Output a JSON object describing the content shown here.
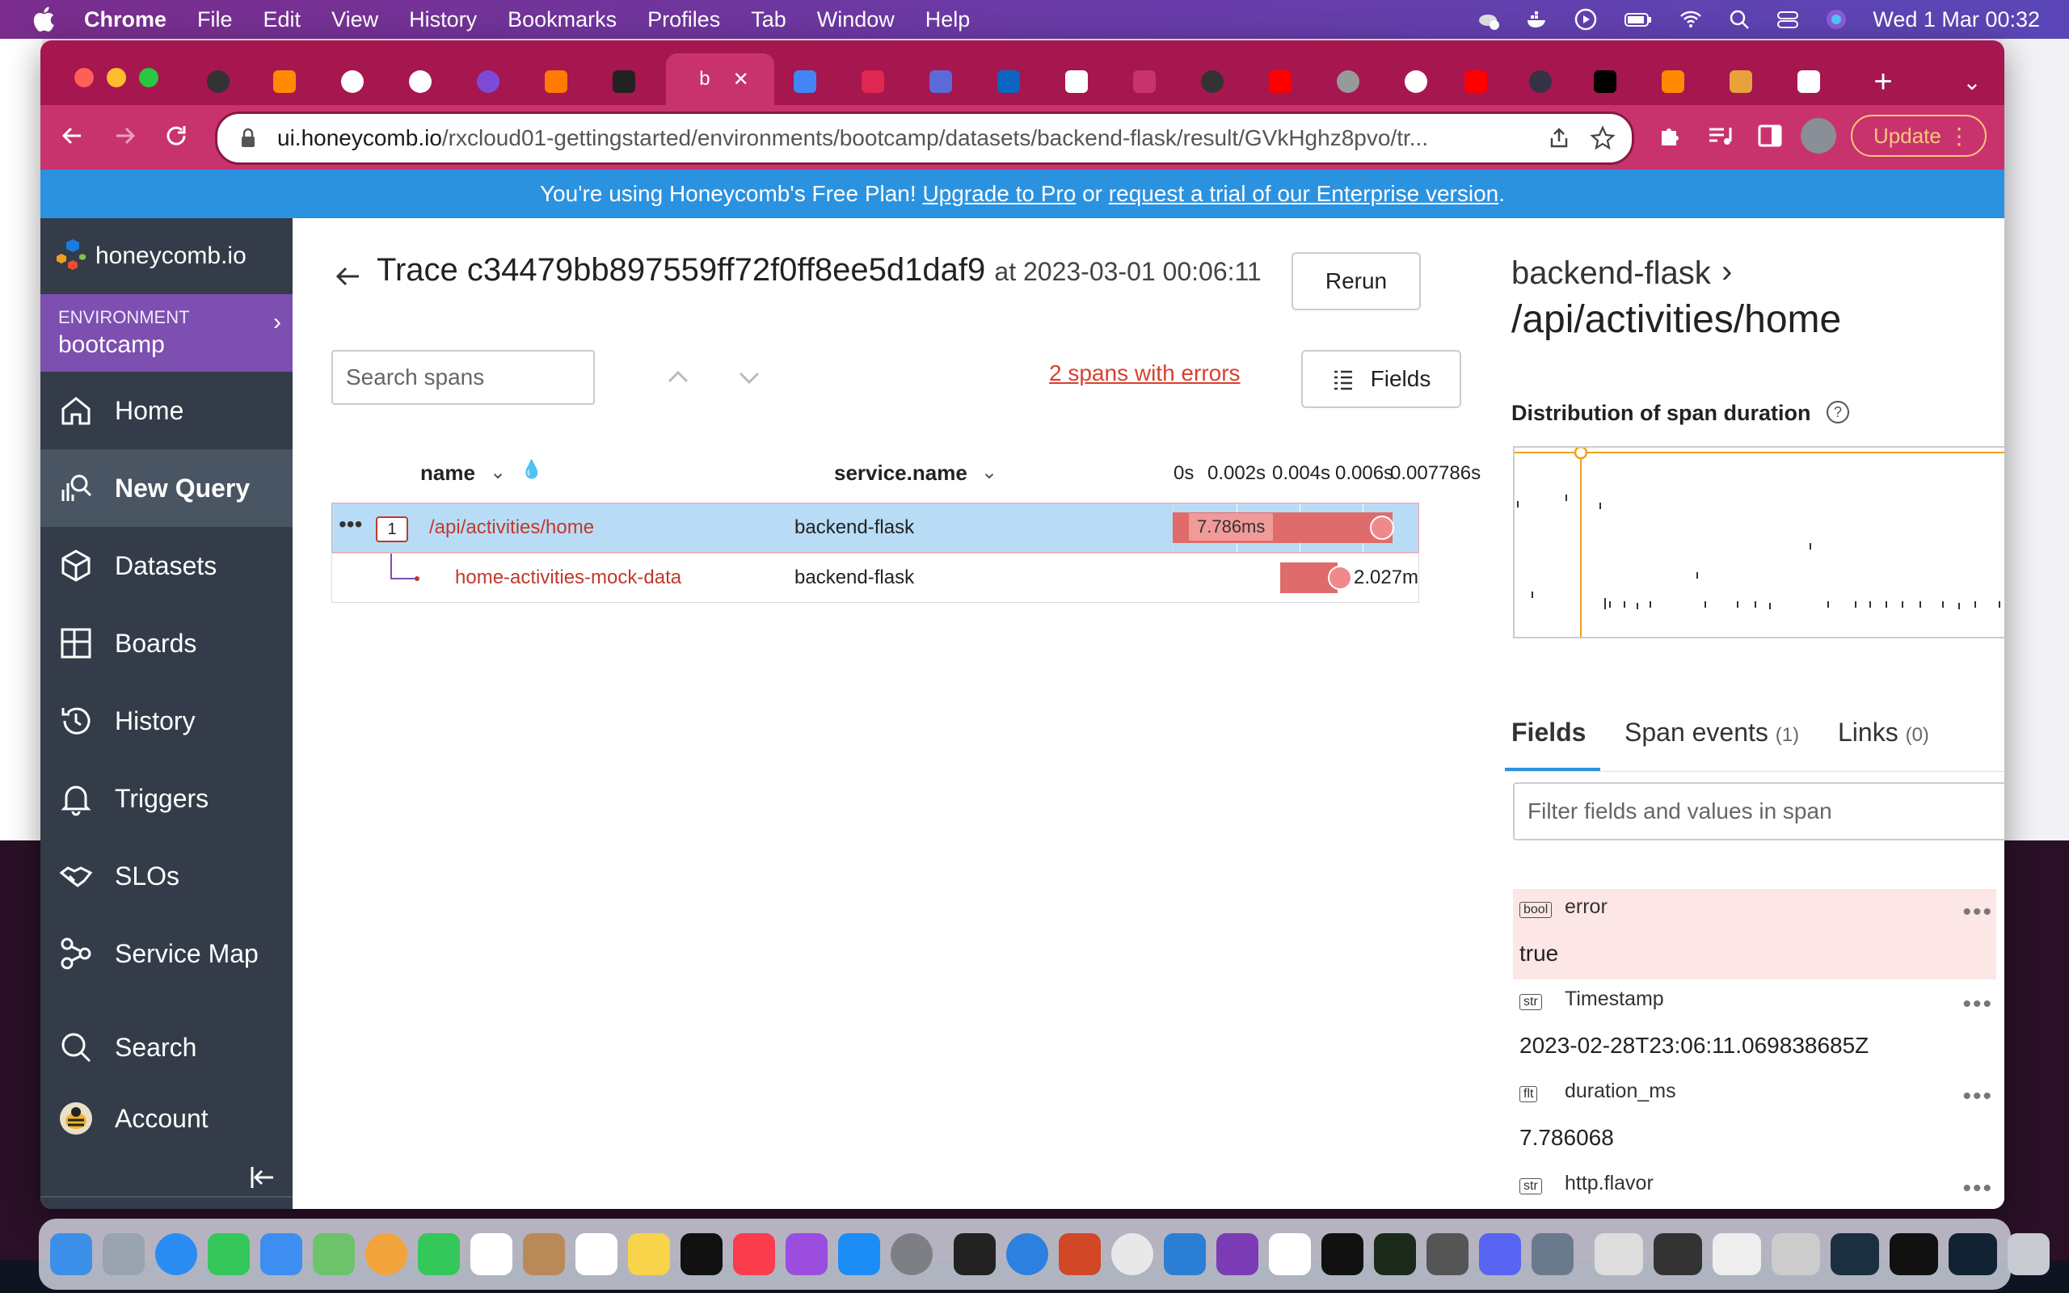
{
  "menubar": {
    "app_name": "Chrome",
    "items": [
      "File",
      "Edit",
      "View",
      "History",
      "Bookmarks",
      "Profiles",
      "Tab",
      "Window",
      "Help"
    ],
    "clock": "Wed 1 Mar  00:32"
  },
  "browser": {
    "active_tab_label": "b",
    "url_host": "ui.honeycomb.io",
    "url_path": "/rxcloud01-gettingstarted/environments/bootcamp/datasets/backend-flask/result/GVkHghz8pvo/tr...",
    "update_label": "Update"
  },
  "banner": {
    "prefix": "You're using Honeycomb's Free Plan!",
    "link1": "Upgrade to Pro",
    "middle": "or",
    "link2": "request a trial of our Enterprise version",
    "suffix": "."
  },
  "sidebar": {
    "logo_text": "honeycomb.io",
    "env_label": "ENVIRONMENT",
    "env_value": "bootcamp",
    "items": [
      {
        "label": "Home",
        "icon": "home-icon"
      },
      {
        "label": "New Query",
        "icon": "query-icon",
        "active": true
      },
      {
        "label": "Datasets",
        "icon": "dataset-icon"
      },
      {
        "label": "Boards",
        "icon": "boards-icon"
      },
      {
        "label": "History",
        "icon": "history-icon"
      },
      {
        "label": "Triggers",
        "icon": "bell-icon"
      },
      {
        "label": "SLOs",
        "icon": "handshake-icon"
      },
      {
        "label": "Service Map",
        "icon": "service-map-icon"
      }
    ],
    "search_label": "Search",
    "account_label": "Account"
  },
  "trace": {
    "title": "Trace c34479bb897559ff72f0ff8ee5d1daf9",
    "at": "at 2023-03-01 00:06:11",
    "rerun_label": "Rerun",
    "search_placeholder": "Search spans",
    "errors_link": "2 spans with errors",
    "fields_label": "Fields",
    "col_name": "name",
    "col_service": "service.name",
    "ticks": [
      "0s",
      "0.002s",
      "0.004s",
      "0.006s",
      "0.007786s"
    ],
    "spans": [
      {
        "count": "1",
        "name": "/api/activities/home",
        "service": "backend-flask",
        "duration": "7.786ms",
        "start_frac": 0.0,
        "len_frac": 1.0
      },
      {
        "name": "home-activities-mock-data",
        "service": "backend-flask",
        "duration": "2.027m",
        "start_frac": 0.49,
        "len_frac": 0.26
      }
    ]
  },
  "detail": {
    "service": "backend-flask",
    "route": "/api/activities/home",
    "dist_title": "Distribution of span duration",
    "tabs": [
      {
        "label": "Fields",
        "count": ""
      },
      {
        "label": "Span events",
        "count": "(1)"
      },
      {
        "label": "Links",
        "count": "(0)"
      }
    ],
    "filter_placeholder": "Filter fields and values in span",
    "fields": [
      {
        "type": "bool",
        "key": "error",
        "value": "true",
        "highlight": true
      },
      {
        "type": "str",
        "key": "Timestamp",
        "value": "2023-02-28T23:06:11.069838685Z"
      },
      {
        "type": "flt",
        "key": "duration_ms",
        "value": "7.786068"
      },
      {
        "type": "str",
        "key": "http.flavor",
        "value": ""
      }
    ]
  },
  "colors": {
    "tabbar": "#a6164f",
    "toolbar": "#c9336d",
    "banner": "#2b92e0",
    "sidebar": "#333c48",
    "env": "#7d4fb0",
    "error_red": "#d9402f",
    "span_bar": "#e06b6b",
    "selected_row": "#b8dcf5",
    "histogram_marker": "#f0a020"
  }
}
